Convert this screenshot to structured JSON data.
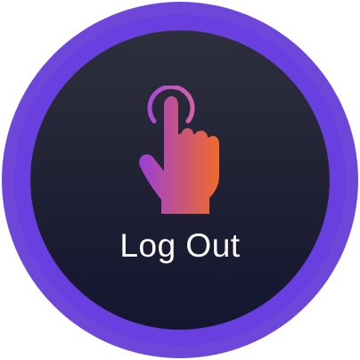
{
  "button": {
    "label": "Log Out",
    "icon": "tap-hand-icon"
  },
  "colors": {
    "ring_outer": "#6E47DA",
    "ring_inner": "#6A3FE0",
    "face_top": "#2E2F3D",
    "face_bottom": "#141530",
    "icon_gradient_start": "#9B3FD8",
    "icon_gradient_end": "#F06A2A",
    "label": "#FFFFFF"
  }
}
